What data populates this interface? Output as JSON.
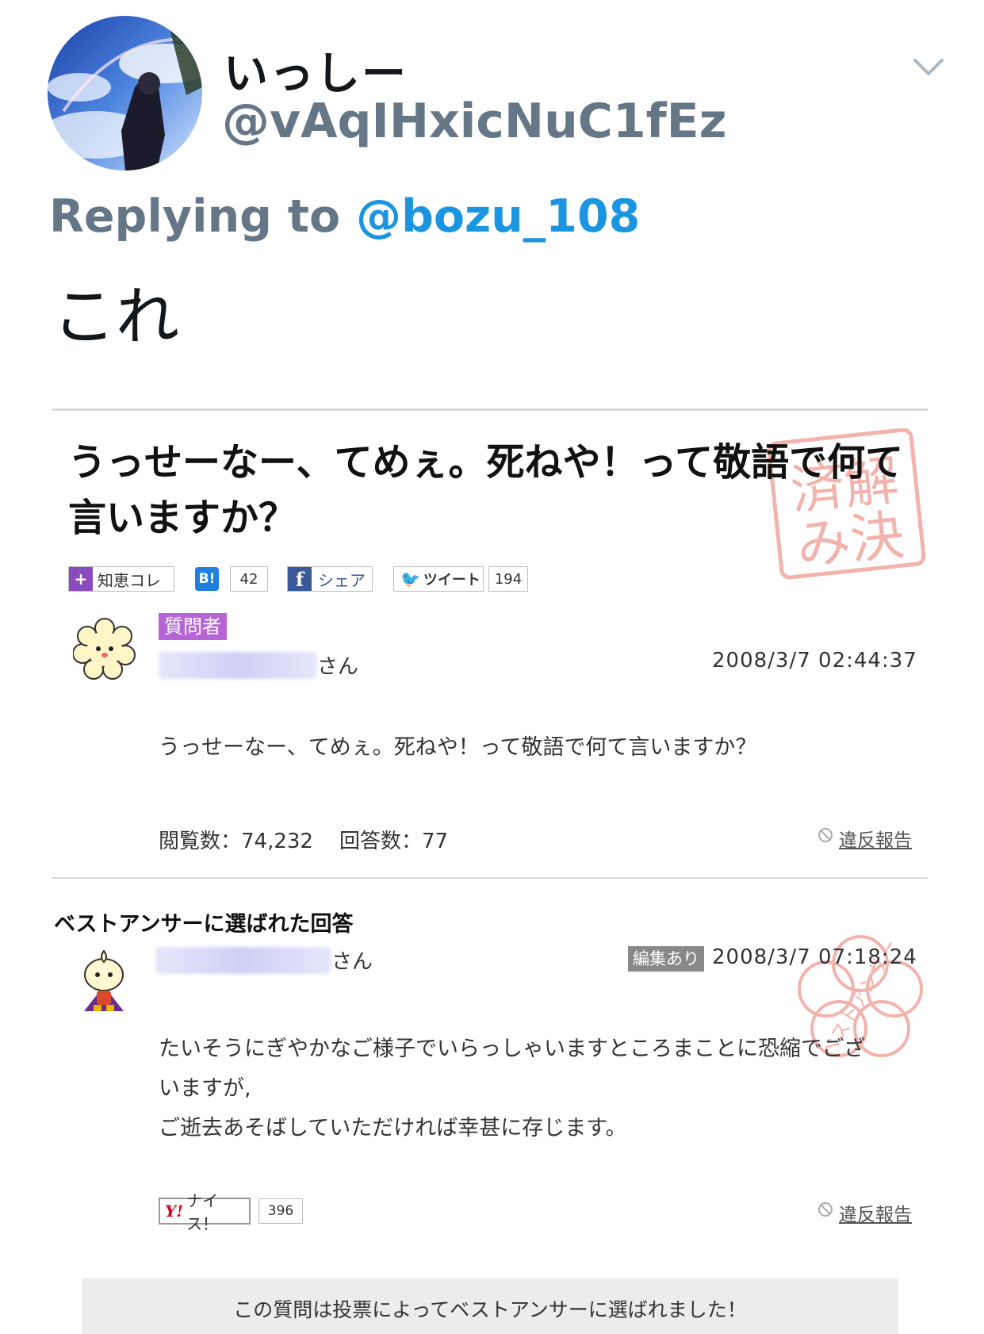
{
  "tweet": {
    "display_name": "いっしー",
    "handle": "@vAqIHxicNuC1fEz",
    "replying_prefix": "Replying to ",
    "replying_to": "@bozu_108",
    "text": "これ"
  },
  "question": {
    "title": "うっせーなー、てめぇ。死ねや！って敬語で何て言いますか？",
    "solved_stamp": "解決済み",
    "share": {
      "chiebukuro_label": "知恵コレ",
      "hatena_label": "B!",
      "hatena_count": "42",
      "facebook_label": "シェア",
      "tweet_label": "ツイート",
      "tweet_count": "194"
    },
    "asker_badge": "質問者",
    "asker_suffix": "さん",
    "date": "2008/3/7  02:44:37",
    "body": "うっせーなー、てめぇ。死ねや！って敬語で何て言いますか？",
    "views_label": "閲覧数：74,232",
    "answers_label": "回答数：77",
    "report_label": "違反報告"
  },
  "best_answer": {
    "heading": "ベストアンサーに選ばれた回答",
    "user_suffix": "さん",
    "edited_badge": "編集あり",
    "date": "2008/3/7  07:18:24",
    "body_line1": "たいそうにぎやかなご様子でいらっしゃいますところまことに恐縮でござ",
    "body_line2": "いますが,",
    "body_line3": "ご逝去あそばしていただければ幸甚に存じます。",
    "nice_logo": "Y!",
    "nice_label": "ナイス！",
    "nice_count": "396",
    "report_label": "違反報告",
    "stamp_text": "ベストアンサー",
    "vote_note": "この質問は投票によってベストアンサーに選ばれました！"
  },
  "colors": {
    "link_blue": "#1b95e0",
    "muted_gray": "#657786",
    "asker_purple": "#b565d6",
    "stamp_red": "#f2b3ad"
  }
}
